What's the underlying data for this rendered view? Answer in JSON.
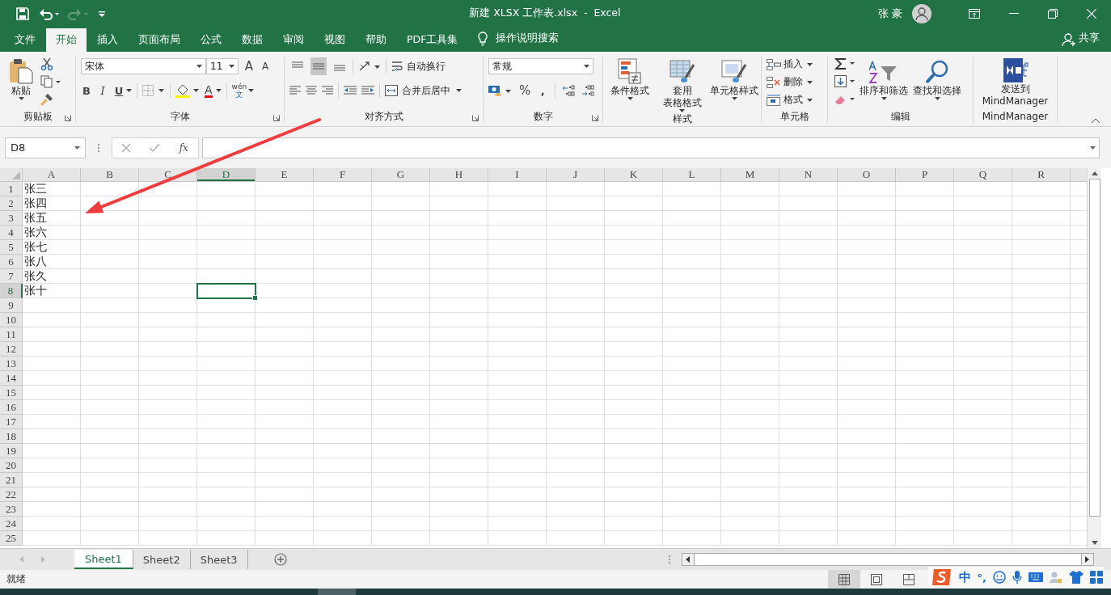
{
  "window": {
    "title": "新建 XLSX 工作表.xlsx  -  Excel",
    "user": "张 豪"
  },
  "menu_tabs": [
    {
      "label": "文件",
      "selected": false
    },
    {
      "label": "开始",
      "selected": true
    },
    {
      "label": "插入",
      "selected": false
    },
    {
      "label": "页面布局",
      "selected": false
    },
    {
      "label": "公式",
      "selected": false
    },
    {
      "label": "数据",
      "selected": false
    },
    {
      "label": "审阅",
      "selected": false
    },
    {
      "label": "视图",
      "selected": false
    },
    {
      "label": "帮助",
      "selected": false
    },
    {
      "label": "PDF工具集",
      "selected": false
    }
  ],
  "tell_me": "操作说明搜索",
  "share": "共享",
  "ribbon": [
    {
      "kind": "clipboard",
      "label": "剪贴板",
      "launcher": true,
      "paste": "粘贴"
    },
    {
      "kind": "font",
      "label": "字体",
      "launcher": true,
      "font": "宋体",
      "size": "11",
      "grow": "A",
      "shrink": "A",
      "bold": "B",
      "italic": "I",
      "underline": "U",
      "font_color": "A",
      "phonetic": [
        "wén",
        "文"
      ]
    },
    {
      "kind": "alignment",
      "label": "对齐方式",
      "launcher": true,
      "vertical": [
        {
          "kind": "top",
          "selected": false
        },
        {
          "kind": "middle",
          "selected": true
        },
        {
          "kind": "bottom",
          "selected": false
        }
      ],
      "wrap": "自动换行",
      "merge": "合并后居中"
    },
    {
      "kind": "number",
      "label": "数字",
      "launcher": true,
      "format": "常规",
      "percent": "%",
      "comma": ","
    },
    {
      "kind": "styles",
      "label": "样式",
      "launcher": false,
      "buttons": [
        {
          "kind": "conditional",
          "lines": [
            "条件格式"
          ]
        },
        {
          "kind": "table",
          "lines": [
            "套用",
            "表格格式"
          ]
        },
        {
          "kind": "cell",
          "lines": [
            "单元格样式"
          ]
        }
      ]
    },
    {
      "kind": "cells",
      "label": "单元格",
      "launcher": false,
      "buttons": [
        {
          "kind": "insert",
          "label": "插入"
        },
        {
          "kind": "delete",
          "label": "删除"
        },
        {
          "kind": "format",
          "label": "格式"
        }
      ]
    },
    {
      "kind": "editing",
      "label": "编辑",
      "launcher": false,
      "buttons": [
        {
          "kind": "sort",
          "label": "排序和筛选"
        },
        {
          "kind": "find",
          "label": "查找和选择"
        }
      ]
    },
    {
      "kind": "addin",
      "label": "MindManager",
      "launcher": false,
      "lines": [
        "发送到",
        "MindManager"
      ]
    }
  ],
  "formula_bar": {
    "name_box": "D8",
    "fx": "fx"
  },
  "columns": [
    {
      "label": "A",
      "selected": false
    },
    {
      "label": "B",
      "selected": false
    },
    {
      "label": "C",
      "selected": false
    },
    {
      "label": "D",
      "selected": true
    },
    {
      "label": "E",
      "selected": false
    },
    {
      "label": "F",
      "selected": false
    },
    {
      "label": "G",
      "selected": false
    },
    {
      "label": "H",
      "selected": false
    },
    {
      "label": "I",
      "selected": false
    },
    {
      "label": "J",
      "selected": false
    },
    {
      "label": "K",
      "selected": false
    },
    {
      "label": "L",
      "selected": false
    },
    {
      "label": "M",
      "selected": false
    },
    {
      "label": "N",
      "selected": false
    },
    {
      "label": "O",
      "selected": false
    },
    {
      "label": "P",
      "selected": false
    },
    {
      "label": "Q",
      "selected": false
    },
    {
      "label": "R",
      "selected": false
    }
  ],
  "rows": [
    {
      "number": "1",
      "selected": false,
      "cells": [
        "张三"
      ]
    },
    {
      "number": "2",
      "selected": false,
      "cells": [
        "张四"
      ]
    },
    {
      "number": "3",
      "selected": false,
      "cells": [
        "张五"
      ]
    },
    {
      "number": "4",
      "selected": false,
      "cells": [
        "张六"
      ]
    },
    {
      "number": "5",
      "selected": false,
      "cells": [
        "张七"
      ]
    },
    {
      "number": "6",
      "selected": false,
      "cells": [
        "张八"
      ]
    },
    {
      "number": "7",
      "selected": false,
      "cells": [
        "张久"
      ]
    },
    {
      "number": "8",
      "selected": true,
      "cells": [
        "张十"
      ]
    },
    {
      "number": "9",
      "selected": false
    },
    {
      "number": "10",
      "selected": false
    },
    {
      "number": "11",
      "selected": false
    },
    {
      "number": "12",
      "selected": false
    },
    {
      "number": "13",
      "selected": false
    },
    {
      "number": "14",
      "selected": false
    },
    {
      "number": "15",
      "selected": false
    },
    {
      "number": "16",
      "selected": false
    },
    {
      "number": "17",
      "selected": false
    },
    {
      "number": "18",
      "selected": false
    },
    {
      "number": "19",
      "selected": false
    },
    {
      "number": "20",
      "selected": false
    },
    {
      "number": "21",
      "selected": false
    },
    {
      "number": "22",
      "selected": false
    },
    {
      "number": "23",
      "selected": false
    },
    {
      "number": "24",
      "selected": false
    },
    {
      "number": "25",
      "selected": false
    }
  ],
  "sheet_tabs": [
    {
      "label": "Sheet1",
      "selected": true
    },
    {
      "label": "Sheet2",
      "selected": false
    },
    {
      "label": "Sheet3",
      "selected": false
    }
  ],
  "status": "就绪",
  "ime": {
    "language": "中",
    "punctuation": "°,"
  }
}
